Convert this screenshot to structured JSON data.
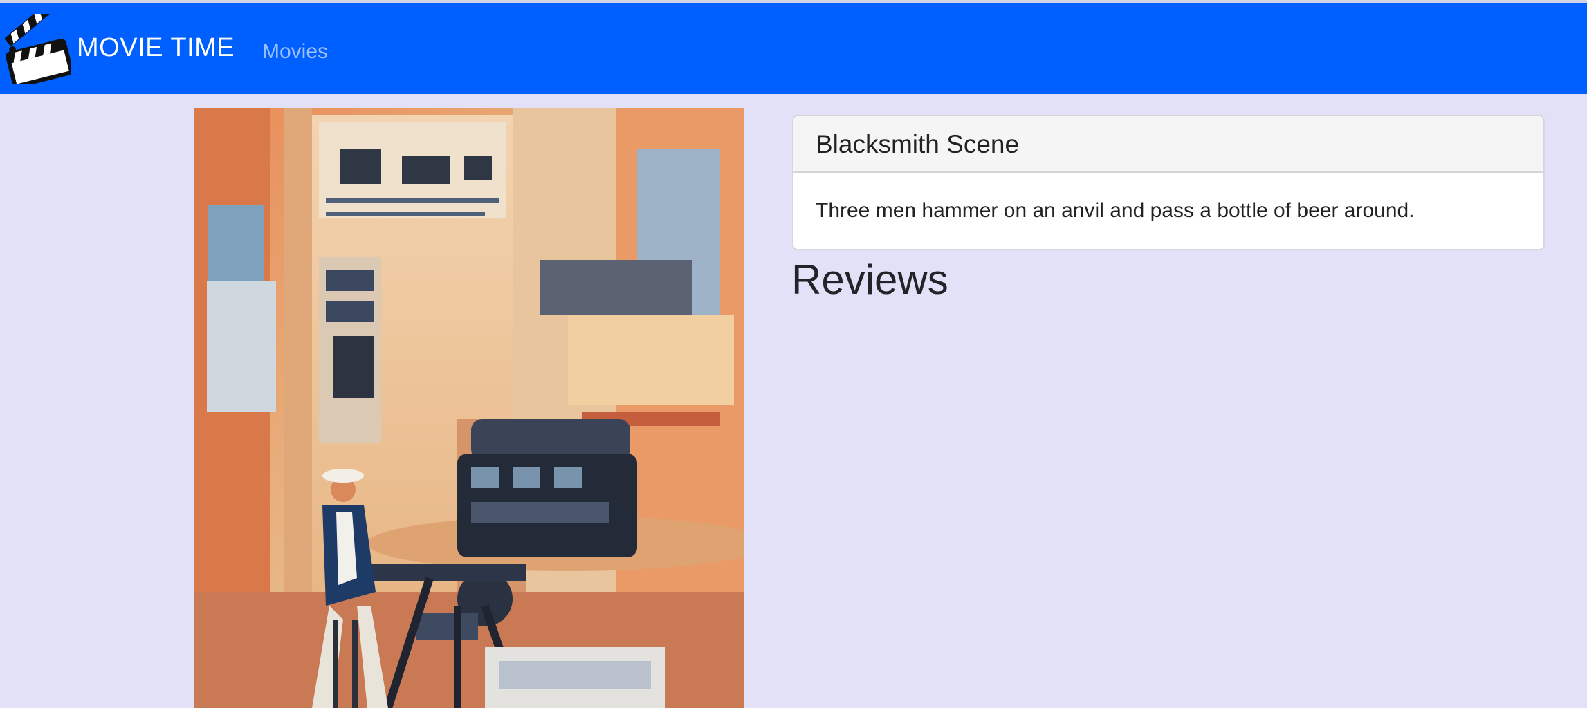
{
  "navbar": {
    "logo_icon": "clapperboard-icon",
    "brand": "MOVIE TIME",
    "links": [
      {
        "label": "Movies"
      }
    ]
  },
  "poster": {
    "icon": "movie-poster-image"
  },
  "movie": {
    "title": "Blacksmith Scene",
    "description": "Three men hammer on an anvil and pass a bottle of beer around."
  },
  "reviews": {
    "heading": "Reviews"
  },
  "colors": {
    "navbar": "#0060ff",
    "background": "#e2e1f8",
    "nav_link": "#9cc0ff"
  }
}
